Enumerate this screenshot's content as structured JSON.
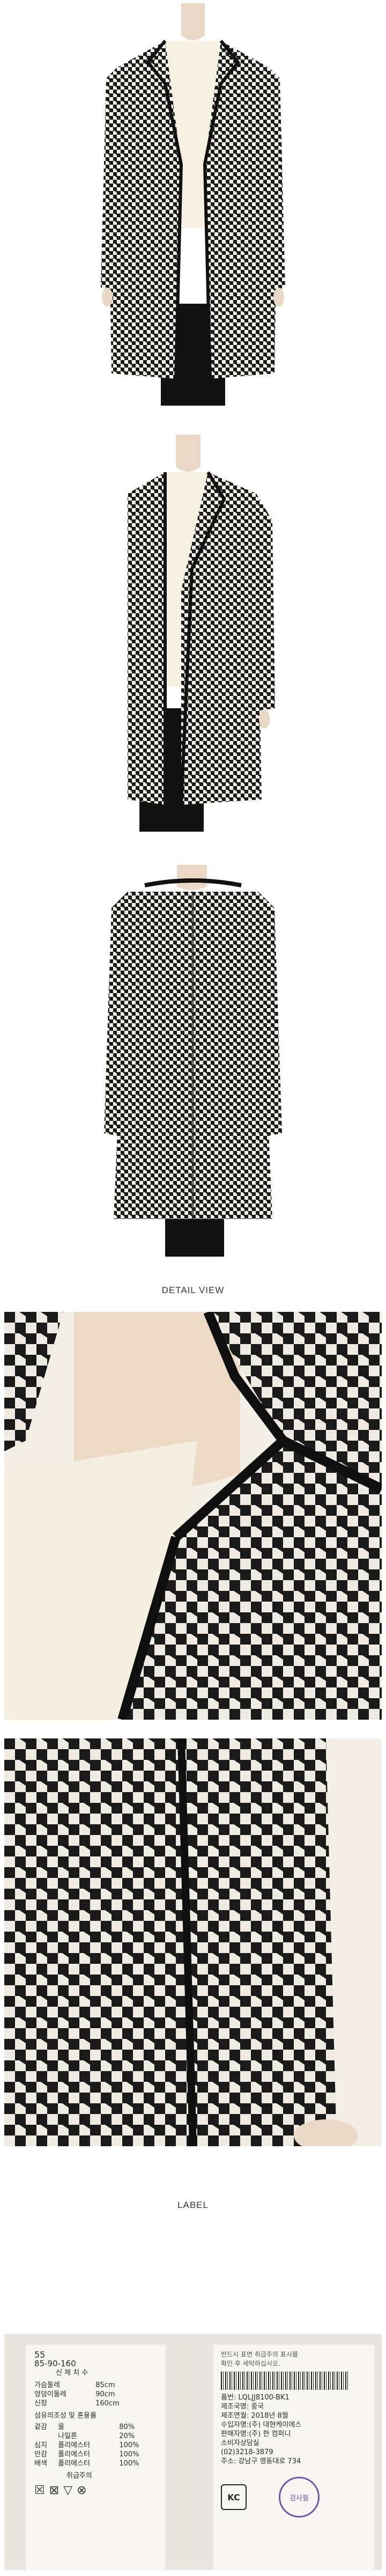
{
  "sections": {
    "detail_view_heading": "DETAIL VIEW",
    "label_heading": "LABEL"
  },
  "label_tag_left": {
    "size": "55",
    "body_size": "85-90-160",
    "size_caption": "신 체 치 수",
    "measures": [
      {
        "name": "가슴둘레",
        "value": "85cm"
      },
      {
        "name": "엉덩이둘레",
        "value": "90cm"
      },
      {
        "name": "신장",
        "value": "160cm"
      }
    ],
    "fiber_caption": "섬유의조성 및 혼용률",
    "fabrics": [
      {
        "part": "겉감",
        "material": "울",
        "pct": "80%"
      },
      {
        "part": "",
        "material": "나일론",
        "pct": "20%"
      },
      {
        "part": "심지",
        "material": "폴리에스터",
        "pct": "100%"
      },
      {
        "part": "안감",
        "material": "폴리에스터",
        "pct": "100%"
      },
      {
        "part": "배색",
        "material": "폴리에스터",
        "pct": "100%"
      }
    ],
    "care_caption": "취급주의"
  },
  "label_tag_right": {
    "lines": [
      "반드시 표면 취급주의 표시를",
      "확인 후 세탁하십시오.",
      "품번: LQLJJ8100-BK1",
      "제조국명: 중국",
      "제조연월: 2018년 8월",
      "수입자명:(주) 대현케이에스",
      "판매자명:(주) 한 컴퍼니",
      "소비자상담실",
      "(02)3218-3879",
      "주소: 강남구 영동대로 734"
    ],
    "kc_mark": "KC",
    "inspection_stamp": "검사필"
  }
}
